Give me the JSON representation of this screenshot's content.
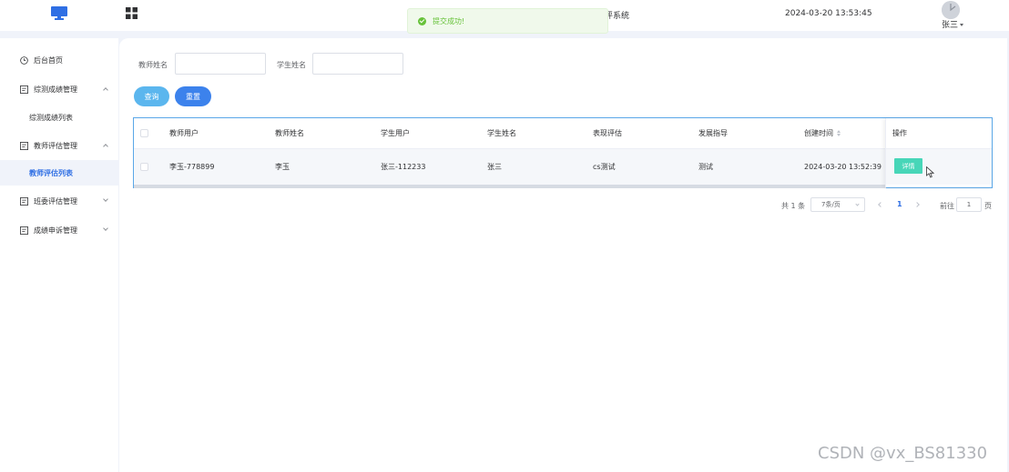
{
  "header": {
    "system_title": "评系统",
    "datetime": "2024-03-20 13:53:45",
    "user_name": "张三"
  },
  "toast": {
    "message": "提交成功!",
    "color": "#67c23a"
  },
  "sidebar": {
    "items": [
      {
        "label": "后台首页",
        "icon": "clock-icon"
      },
      {
        "label": "综测成绩管理",
        "icon": "file-icon",
        "expanded": true,
        "children": [
          {
            "label": "综测成绩列表"
          }
        ]
      },
      {
        "label": "教师评估管理",
        "icon": "file-icon",
        "expanded": true,
        "children": [
          {
            "label": "教师评估列表",
            "active": true
          }
        ]
      },
      {
        "label": "班委评估管理",
        "icon": "file-icon",
        "expanded": false
      },
      {
        "label": "成绩申诉管理",
        "icon": "file-icon",
        "expanded": false
      }
    ]
  },
  "search": {
    "teacher_label": "教师姓名",
    "teacher_value": "",
    "student_label": "学生姓名",
    "student_value": "",
    "query_button": "查询",
    "reset_button": "重置"
  },
  "table": {
    "columns": [
      "教师用户",
      "教师姓名",
      "学生用户",
      "学生姓名",
      "表现评估",
      "发展指导",
      "创建时间",
      "操作"
    ],
    "rows": [
      {
        "teacher_user": "李玉-778899",
        "teacher_name": "李玉",
        "student_user": "张三-112233",
        "student_name": "张三",
        "evaluation": "cs测试",
        "guidance": "测试",
        "created_at": "2024-03-20 13:52:39",
        "action": "详情"
      }
    ]
  },
  "pagination": {
    "total": "共 1 条",
    "page_size": "7条/页",
    "current_page": "1",
    "goto_label": "前往",
    "goto_value": "1",
    "goto_unit": "页"
  },
  "colors": {
    "accent": "#2f6fe4",
    "query_button": "#5bb6ee",
    "reset_button": "#3c82ec",
    "detail_button": "#47d6b8"
  },
  "watermark": "CSDN @vx_BS81330"
}
